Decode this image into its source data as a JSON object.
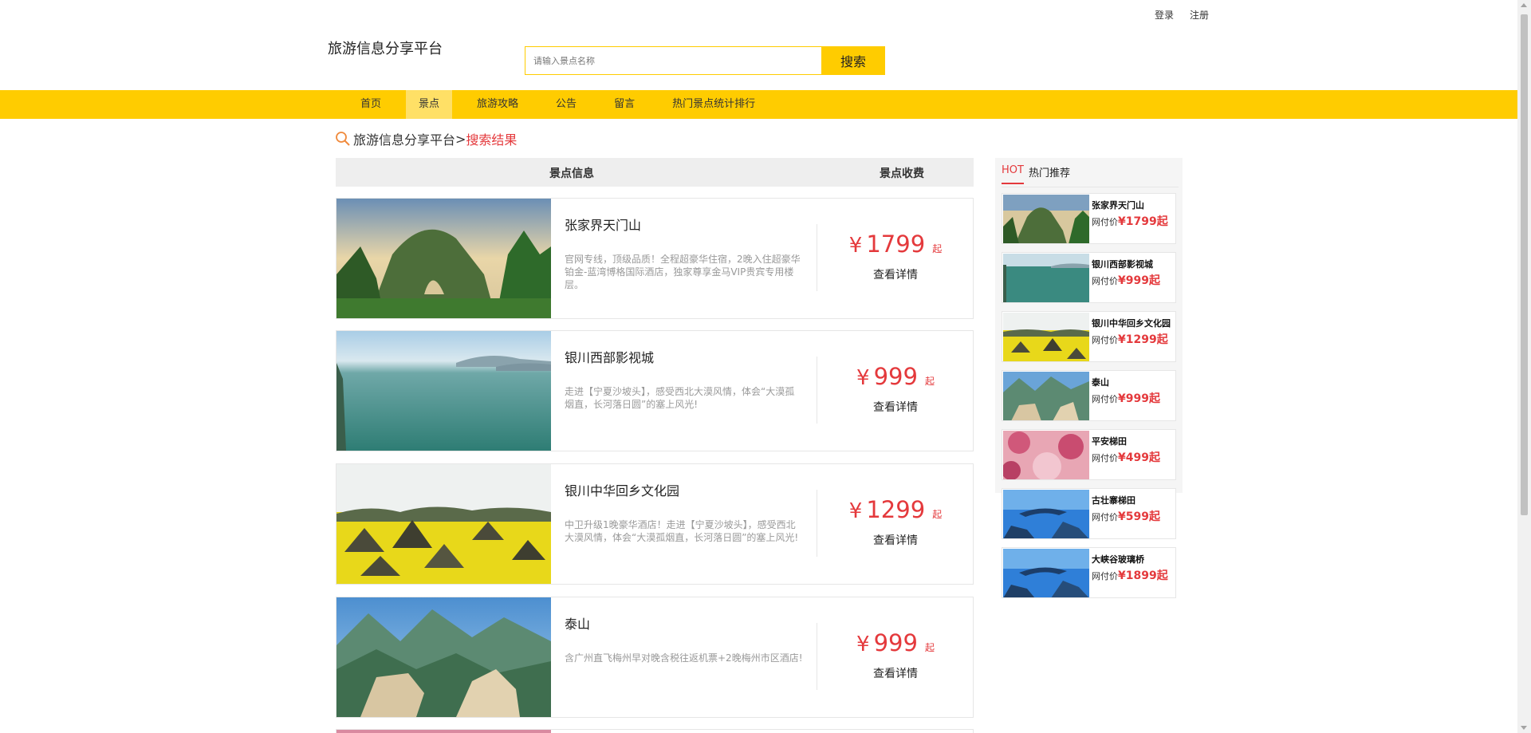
{
  "header": {
    "login": "登录",
    "register": "注册",
    "site_title": "旅游信息分享平台",
    "search_placeholder": "请输入景点名称",
    "search_button": "搜索"
  },
  "nav": {
    "items": [
      "首页",
      "景点",
      "旅游攻略",
      "公告",
      "留言",
      "热门景点统计排行"
    ],
    "active_index": 1
  },
  "breadcrumb": {
    "home": "旅游信息分享平台",
    "sep": ">",
    "current": "搜索结果"
  },
  "results": {
    "col_info": "景点信息",
    "col_fee": "景点收费",
    "items": [
      {
        "name": "张家界天门山",
        "desc": "官网专线，顶级品质！全程超豪华住宿，2晚入住超豪华铂金-蓝湾博格国际酒店，独家尊享金马VIP贵宾专用楼层。",
        "currency": "¥",
        "price": "1799",
        "suffix": "起",
        "detail": "查看详情",
        "image_icon": "mountain-arch-image"
      },
      {
        "name": "银川西部影视城",
        "desc": "走进【宁夏沙坡头】，感受西北大漠风情，体会“大漠孤烟直，长河落日圆”的塞上风光!",
        "currency": "¥",
        "price": "999",
        "suffix": "起",
        "detail": "查看详情",
        "image_icon": "lake-image"
      },
      {
        "name": "银川中华回乡文化园",
        "desc": "中卫升级1晚豪华酒店！走进【宁夏沙坡头】，感受西北大漠风情，体会“大漠孤烟直，长河落日圆”的塞上风光!",
        "currency": "¥",
        "price": "1299",
        "suffix": "起",
        "detail": "查看详情",
        "image_icon": "rapeseed-field-image"
      },
      {
        "name": "泰山",
        "desc": "含广州直飞梅州早对晚含税往返机票+2晚梅州市区酒店!",
        "currency": "¥",
        "price": "999",
        "suffix": "起",
        "detail": "查看详情",
        "image_icon": "rocky-mountain-image"
      }
    ]
  },
  "hot": {
    "label": "HOT",
    "title": "热门推荐",
    "price_prefix": "网付价",
    "items": [
      {
        "name": "张家界天门山",
        "price": "¥1799起"
      },
      {
        "name": "银川西部影视城",
        "price": "¥999起"
      },
      {
        "name": "银川中华回乡文化园",
        "price": "¥1299起"
      },
      {
        "name": "泰山",
        "price": "¥999起"
      },
      {
        "name": "平安梯田",
        "price": "¥499起"
      },
      {
        "name": "古壮寨梯田",
        "price": "¥599起"
      },
      {
        "name": "大峡谷玻璃桥",
        "price": "¥1899起"
      }
    ]
  },
  "colors": {
    "accent": "#ffcc00",
    "price_red": "#e4393c"
  }
}
